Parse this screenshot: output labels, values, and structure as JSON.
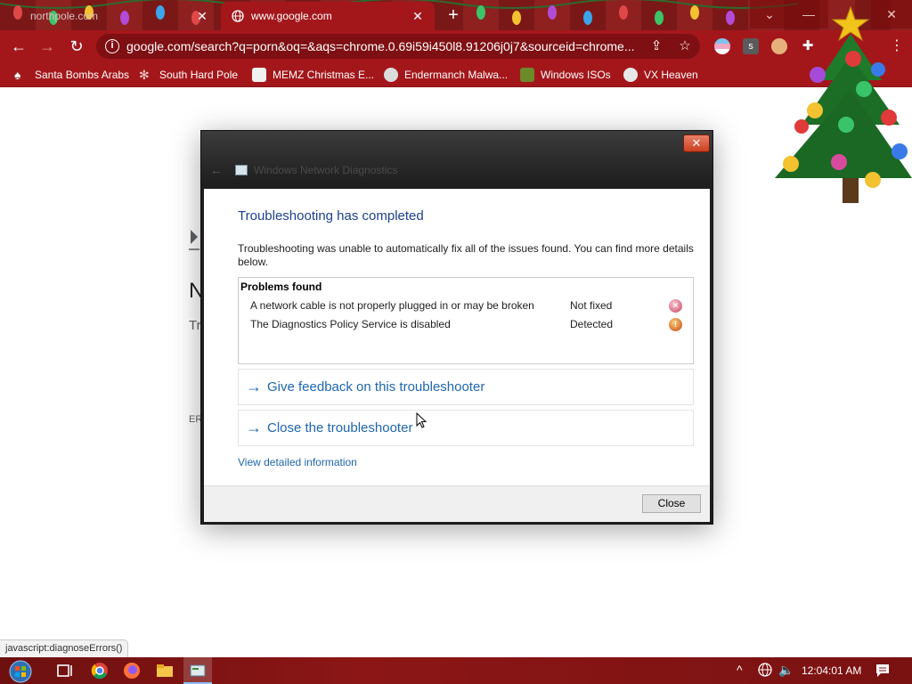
{
  "browser": {
    "tabs": [
      {
        "title": "northpole.com",
        "active": false
      },
      {
        "title": "www.google.com",
        "active": true
      }
    ],
    "newtab_icon": "plus-icon",
    "url": "google.com/search?q=porn&oq=&aqs=chrome.0.69i59i450l8.91206j0j7&sourceid=chrome...",
    "bookmarks": [
      {
        "label": "Santa Bombs Arabs"
      },
      {
        "label": "South Hard Pole"
      },
      {
        "label": "MEMZ Christmas E..."
      },
      {
        "label": "Endermanch Malwa..."
      },
      {
        "label": "Windows ISOs"
      },
      {
        "label": "VX Heaven"
      }
    ],
    "accent_color": "#a3171b"
  },
  "page_behind": {
    "letter_n": "N",
    "text_tr": "Tr",
    "text_er": "ER"
  },
  "dialog": {
    "window_title": "Windows Network Diagnostics",
    "close_x": "✕",
    "heading": "Troubleshooting has completed",
    "description": "Troubleshooting was unable to automatically fix all of the issues found. You can find more details below.",
    "problems_header": "Problems found",
    "problems": [
      {
        "description": "A network cable is not properly plugged in or may be broken",
        "status": "Not fixed",
        "icon": "error-x-icon"
      },
      {
        "description": "The Diagnostics Policy Service is disabled",
        "status": "Detected",
        "icon": "warning-icon"
      }
    ],
    "links": [
      {
        "label": "Give feedback on this troubleshooter"
      },
      {
        "label": "Close the troubleshooter"
      }
    ],
    "detail_link": "View detailed information",
    "close_button": "Close"
  },
  "status_bar": "javascript:diagnoseErrors()",
  "taskbar": {
    "time": "12:04:01 AM"
  }
}
